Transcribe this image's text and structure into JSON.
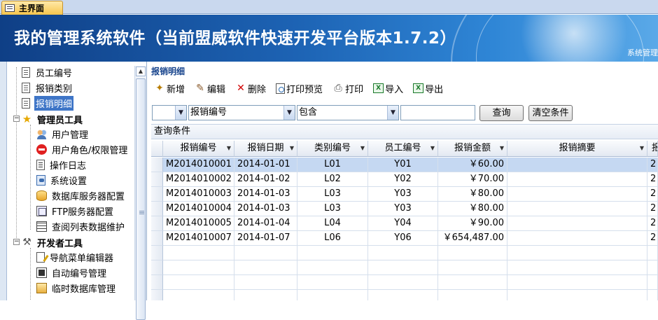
{
  "doc_tab": {
    "label": "主界面"
  },
  "banner": {
    "title": "我的管理系统软件（当前盟威软件快速开发平台版本1.7.2）",
    "subtitle": "系统管理"
  },
  "sidebar": {
    "items": [
      {
        "label": "员工编号",
        "icon": "document-icon",
        "level": 1,
        "selected": false
      },
      {
        "label": "报销类别",
        "icon": "document-icon",
        "level": 1,
        "selected": false
      },
      {
        "label": "报销明细",
        "icon": "document-icon",
        "level": 1,
        "selected": true
      },
      {
        "label": "管理员工具",
        "icon": "star-icon",
        "level": 0,
        "group": true
      },
      {
        "label": "用户管理",
        "icon": "users-icon",
        "level": 1
      },
      {
        "label": "用户角色/权限管理",
        "icon": "stop-icon",
        "level": 1
      },
      {
        "label": "操作日志",
        "icon": "log-icon",
        "level": 1
      },
      {
        "label": "系统设置",
        "icon": "settings-icon",
        "level": 1
      },
      {
        "label": "数据库服务器配置",
        "icon": "database-icon",
        "level": 1
      },
      {
        "label": "FTP服务器配置",
        "icon": "ftp-icon",
        "level": 1
      },
      {
        "label": "查阅列表数据维护",
        "icon": "grid-icon",
        "level": 1
      },
      {
        "label": "开发者工具",
        "icon": "tools-icon",
        "level": 0,
        "group": true
      },
      {
        "label": "导航菜单编辑器",
        "icon": "edit-icon",
        "level": 1
      },
      {
        "label": "自动编号管理",
        "icon": "numbering-icon",
        "level": 1
      },
      {
        "label": "临时数据库管理",
        "icon": "temp-db-icon",
        "level": 1
      }
    ]
  },
  "main": {
    "title": "报销明细",
    "toolbar": {
      "new": "新增",
      "edit": "编辑",
      "delete": "删除",
      "print_preview": "打印预览",
      "print": "打印",
      "import": "导入",
      "export": "导出"
    },
    "filter": {
      "logic_value": "",
      "field_value": "报销编号",
      "operator_value": "包含",
      "keyword_value": "",
      "query_button": "查询",
      "clear_button": "清空条件"
    },
    "condition_label": "查询条件",
    "table": {
      "columns": [
        "报销编号",
        "报销日期",
        "类别编号",
        "员工编号",
        "报销金额",
        "报销摘要",
        "报"
      ],
      "rows": [
        [
          "M2014010001",
          "2014-01-01",
          "L01",
          "Y01",
          "￥60.00",
          "",
          "2"
        ],
        [
          "M2014010002",
          "2014-01-02",
          "L02",
          "Y02",
          "￥70.00",
          "",
          "2"
        ],
        [
          "M2014010003",
          "2014-01-03",
          "L03",
          "Y03",
          "￥80.00",
          "",
          "2"
        ],
        [
          "M2014010004",
          "2014-01-03",
          "L03",
          "Y03",
          "￥80.00",
          "",
          "2"
        ],
        [
          "M2014010005",
          "2014-01-04",
          "L04",
          "Y04",
          "￥90.00",
          "",
          "2"
        ],
        [
          "M2014010007",
          "2014-01-07",
          "L06",
          "Y06",
          "￥654,487.00",
          "",
          "2"
        ]
      ],
      "selected_row": 0
    }
  }
}
